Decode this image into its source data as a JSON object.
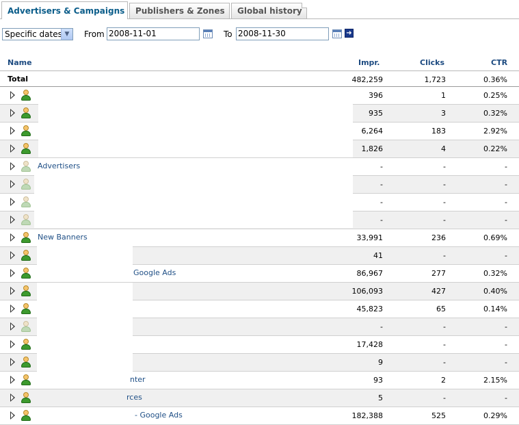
{
  "tabs": [
    {
      "label": "Advertisers & Campaigns",
      "active": true
    },
    {
      "label": "Publishers & Zones",
      "active": false
    },
    {
      "label": "Global history",
      "active": false
    }
  ],
  "filter": {
    "period_select": "Specific dates",
    "from_label": "From",
    "from_value": "2008-11-01",
    "to_label": "To",
    "to_value": "2008-11-30"
  },
  "table": {
    "headers": {
      "name": "Name",
      "impr": "Impr.",
      "clicks": "Clicks",
      "ctr": "CTR"
    },
    "total": {
      "name": "Total",
      "impr": "482,259",
      "clicks": "1,723",
      "ctr": "0.36%"
    },
    "rows": [
      {
        "name": "",
        "impr": "396",
        "clicks": "1",
        "ctr": "0.25%",
        "active": true
      },
      {
        "name": "",
        "impr": "935",
        "clicks": "3",
        "ctr": "0.32%",
        "active": true
      },
      {
        "name": "",
        "impr": "6,264",
        "clicks": "183",
        "ctr": "2.92%",
        "active": true
      },
      {
        "name": "",
        "impr": "1,826",
        "clicks": "4",
        "ctr": "0.22%",
        "active": true
      },
      {
        "name": "Advertisers",
        "impr": "-",
        "clicks": "-",
        "ctr": "-",
        "active": false
      },
      {
        "name": "",
        "impr": "-",
        "clicks": "-",
        "ctr": "-",
        "active": false
      },
      {
        "name": "",
        "impr": "-",
        "clicks": "-",
        "ctr": "-",
        "active": false
      },
      {
        "name": "",
        "impr": "-",
        "clicks": "-",
        "ctr": "-",
        "active": false
      },
      {
        "name": "New Banners",
        "impr": "33,991",
        "clicks": "236",
        "ctr": "0.69%",
        "active": true
      },
      {
        "name": "",
        "impr": "41",
        "clicks": "-",
        "ctr": "-",
        "active": true
      },
      {
        "name": "Google Ads",
        "impr": "86,967",
        "clicks": "277",
        "ctr": "0.32%",
        "active": true
      },
      {
        "name": "",
        "impr": "106,093",
        "clicks": "427",
        "ctr": "0.40%",
        "active": true
      },
      {
        "name": "",
        "impr": "45,823",
        "clicks": "65",
        "ctr": "0.14%",
        "active": true
      },
      {
        "name": "",
        "impr": "-",
        "clicks": "-",
        "ctr": "-",
        "active": false
      },
      {
        "name": "",
        "impr": "17,428",
        "clicks": "-",
        "ctr": "-",
        "active": true
      },
      {
        "name": "",
        "impr": "9",
        "clicks": "-",
        "ctr": "-",
        "active": true
      },
      {
        "name": "nter",
        "impr": "93",
        "clicks": "2",
        "ctr": "2.15%",
        "active": true
      },
      {
        "name": "rces",
        "impr": "5",
        "clicks": "-",
        "ctr": "-",
        "active": true
      },
      {
        "name": "- Google Ads",
        "impr": "182,388",
        "clicks": "525",
        "ctr": "0.29%",
        "active": true
      }
    ]
  },
  "icons": [
    "expand-triangle-icon",
    "advertiser-user-icon",
    "calendar-icon",
    "go-arrow-icon"
  ]
}
